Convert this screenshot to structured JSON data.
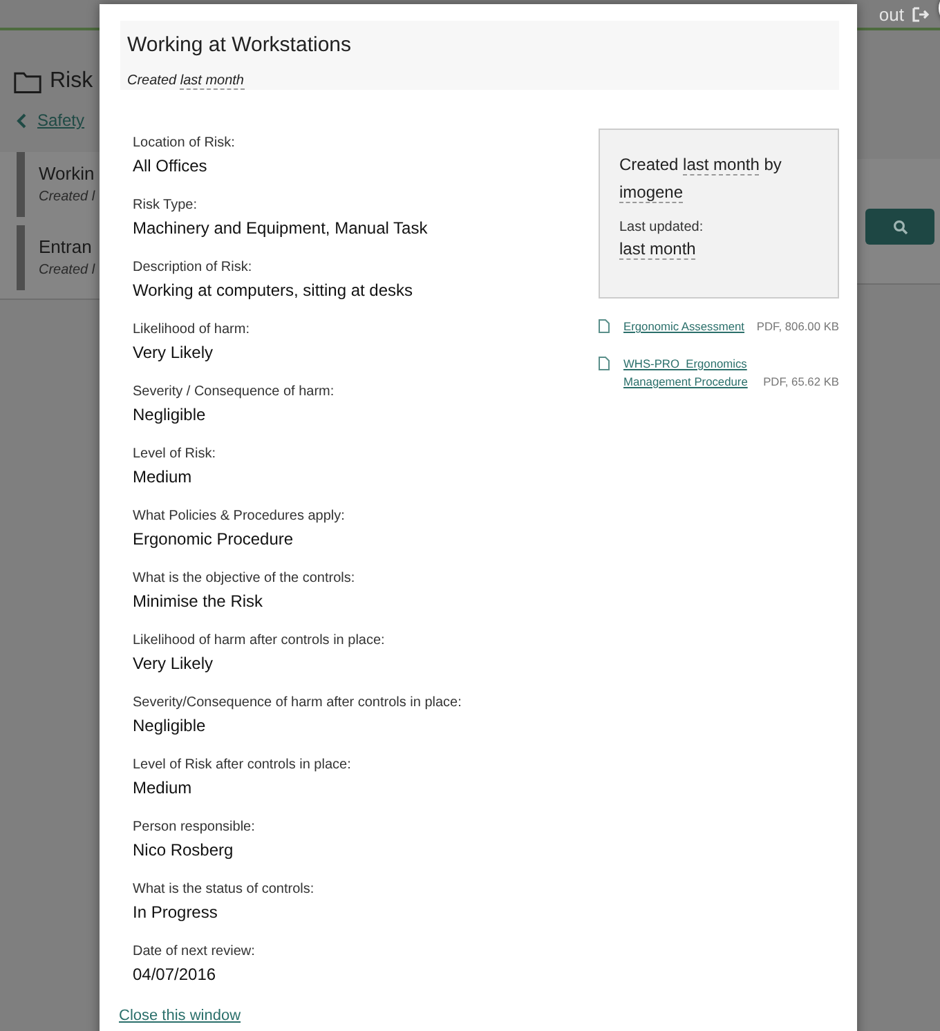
{
  "background": {
    "logout": "out",
    "page_title": "Risk",
    "breadcrumb": "Safety",
    "items": [
      {
        "title": "Workin",
        "subtitle": "Created l"
      },
      {
        "title": "Entran",
        "subtitle": "Created l"
      }
    ]
  },
  "modal": {
    "title": "Working at Workstations",
    "created_prefix": "Created",
    "created_when": "last month",
    "fields": [
      {
        "label": "Location of Risk:",
        "value": "All Offices"
      },
      {
        "label": "Risk Type:",
        "value": "Machinery and Equipment, Manual Task"
      },
      {
        "label": "Description of Risk:",
        "value": "Working at computers, sitting at desks"
      },
      {
        "label": "Likelihood of harm:",
        "value": "Very Likely"
      },
      {
        "label": "Severity / Consequence of harm:",
        "value": "Negligible"
      },
      {
        "label": "Level of Risk:",
        "value": "Medium"
      },
      {
        "label": "What Policies & Procedures apply:",
        "value": "Ergonomic Procedure"
      },
      {
        "label": "What is the objective of the controls:",
        "value": "Minimise the Risk"
      },
      {
        "label": "Likelihood of harm after controls in place:",
        "value": "Very Likely"
      },
      {
        "label": "Severity/Consequence of harm after controls in place:",
        "value": "Negligible"
      },
      {
        "label": "Level of Risk after controls in place:",
        "value": "Medium"
      },
      {
        "label": "Person responsible:",
        "value": "Nico Rosberg"
      },
      {
        "label": "What is the status of controls:",
        "value": "In Progress"
      },
      {
        "label": "Date of next review:",
        "value": "04/07/2016"
      }
    ],
    "info": {
      "created": "Created",
      "created_when": "last month",
      "by": "by",
      "author": "imogene",
      "updated_label": "Last updated:",
      "updated_when": "last month"
    },
    "attachments": [
      {
        "name": "Ergonomic Assessment",
        "meta": "PDF, 806.00 KB"
      },
      {
        "name": "WHS-PRO_Ergonomics Management Procedure",
        "meta": "PDF, 65.62 KB"
      }
    ],
    "close_link": "Close this window"
  }
}
